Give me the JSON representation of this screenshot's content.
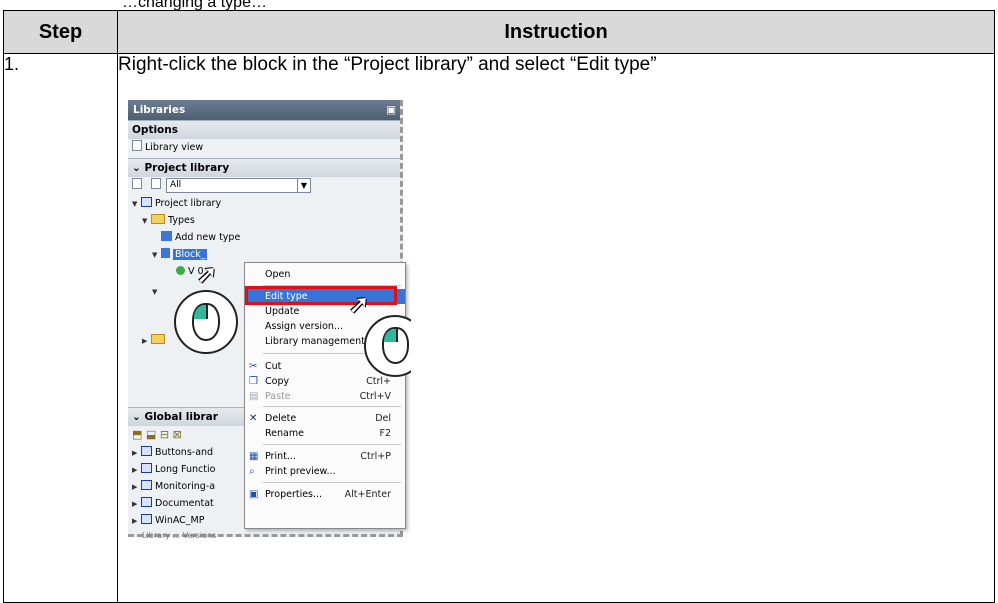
{
  "intro_fragment": "…changing a type…",
  "table": {
    "header": {
      "step": "Step",
      "instruction": "Instruction"
    },
    "rows": [
      {
        "step": "1.",
        "instruction": "Right-click the block in the “Project library” and select “Edit type”"
      }
    ]
  },
  "screenshot": {
    "panel_title": "Libraries",
    "options_label": "Options",
    "library_view_label": "Library view",
    "project_library_header": "Project library",
    "filter_value": "All",
    "tree": {
      "project_library": "Project library",
      "types": "Types",
      "add_new_type": "Add new type",
      "block": "Block_",
      "version": "V 0."
    },
    "global_libraries_header": "Global librar",
    "global_items": [
      "Buttons-and",
      "Long Functio",
      "Monitoring-a",
      "Documentat",
      "WinAC_MP"
    ],
    "cut_off_item": "Library ... Versions",
    "context_menu": [
      {
        "label": "Open",
        "key": "",
        "icon": ""
      },
      {
        "label": "Edit type",
        "key": "",
        "icon": "",
        "highlighted": true
      },
      {
        "label": "Update",
        "key": "",
        "icon": ""
      },
      {
        "label": "Assign version...",
        "key": "",
        "icon": ""
      },
      {
        "label": "Library management",
        "key": "",
        "icon": ""
      },
      {
        "label": "Cut",
        "key": "Ct",
        "icon": "scissors-icon"
      },
      {
        "label": "Copy",
        "key": "Ctrl+",
        "icon": "copy-icon"
      },
      {
        "label": "Paste",
        "key": "Ctrl+V",
        "icon": "paste-icon",
        "disabled": true
      },
      {
        "label": "Delete",
        "key": "Del",
        "icon": "delete-x-icon"
      },
      {
        "label": "Rename",
        "key": "F2",
        "icon": ""
      },
      {
        "label": "Print...",
        "key": "Ctrl+P",
        "icon": "print-icon"
      },
      {
        "label": "Print preview...",
        "key": "",
        "icon": "print-preview-icon"
      },
      {
        "label": "Properties...",
        "key": "Alt+Enter",
        "icon": "properties-icon"
      }
    ]
  },
  "colors": {
    "header_bg": "#d9d9d9",
    "menu_highlight": "#3874d8",
    "frame_red": "#e0101a",
    "mouse_button": "#2fb89a"
  }
}
